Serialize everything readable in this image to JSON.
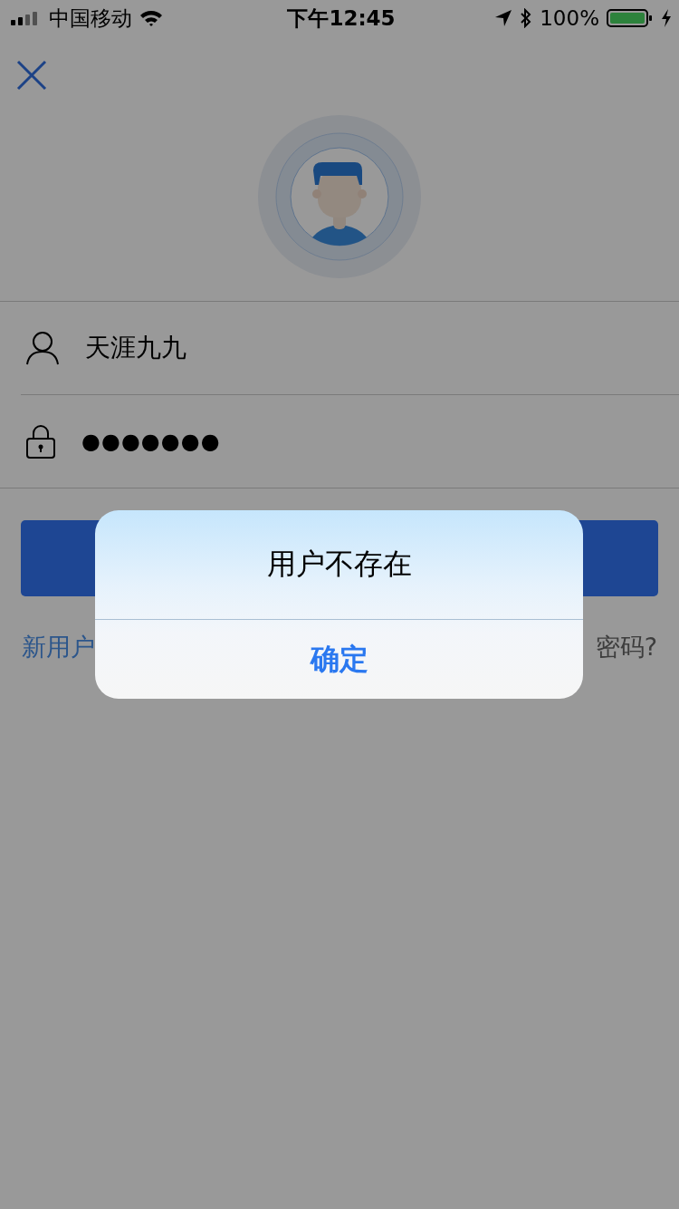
{
  "status_bar": {
    "carrier": "中国移动",
    "time": "下午12:45",
    "battery": "100%"
  },
  "login": {
    "username": "天涯九九",
    "password": "●●●●●●●",
    "register_link": "新用户",
    "forgot_link": "密码?"
  },
  "alert": {
    "message": "用户不存在",
    "button": "确定"
  }
}
